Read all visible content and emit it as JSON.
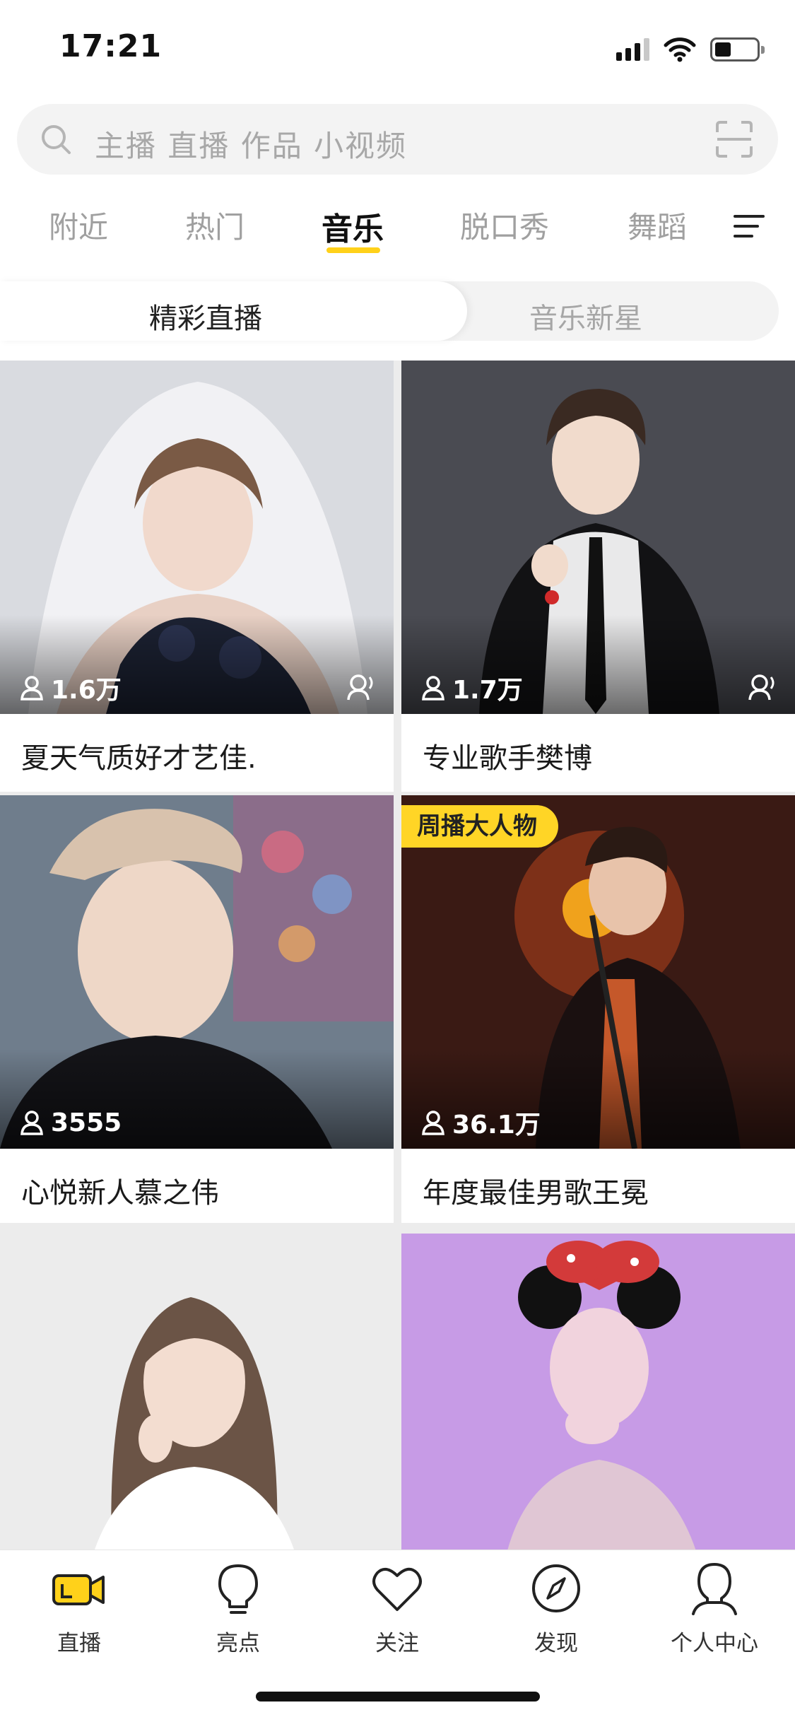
{
  "status_bar": {
    "time": "17:21"
  },
  "search": {
    "placeholder": "主播 直播 作品 小视频"
  },
  "category_tabs": [
    {
      "label": "附近",
      "active": false
    },
    {
      "label": "热门",
      "active": false
    },
    {
      "label": "音乐",
      "active": true
    },
    {
      "label": "脱口秀",
      "active": false
    },
    {
      "label": "舞蹈",
      "active": false
    }
  ],
  "segments": [
    {
      "label": "精彩直播",
      "active": true
    },
    {
      "label": "音乐新星",
      "active": false
    }
  ],
  "cards": [
    {
      "title": "夏天气质好才艺佳.",
      "viewers": "1.6万",
      "badge": "",
      "has_mic": true,
      "palette": [
        "#d9dbe0",
        "#8a8e98",
        "#1c2233"
      ]
    },
    {
      "title": "专业歌手樊博",
      "viewers": "1.7万",
      "badge": "",
      "has_mic": true,
      "palette": [
        "#4a4b52",
        "#e9e9ea",
        "#121214"
      ]
    },
    {
      "title": "心悦新人慕之伟",
      "viewers": "3555",
      "badge": "",
      "has_mic": false,
      "palette": [
        "#6f7d8c",
        "#d8c2ad",
        "#141418"
      ]
    },
    {
      "title": "年度最佳男歌王冕",
      "viewers": "36.1万",
      "badge": "周播大人物",
      "has_mic": false,
      "palette": [
        "#3a1a14",
        "#f0a21c",
        "#1a1010"
      ]
    },
    {
      "title": "",
      "viewers": "",
      "badge": "",
      "has_mic": false,
      "palette": [
        "#ececec",
        "#d5c6bb",
        "#6b5446"
      ]
    },
    {
      "title": "",
      "viewers": "",
      "badge": "",
      "has_mic": false,
      "palette": [
        "#c79be6",
        "#f1d3dd",
        "#d33a3a"
      ]
    }
  ],
  "bottom_nav": [
    {
      "label": "直播",
      "icon": "live-camera-icon",
      "active": true
    },
    {
      "label": "亮点",
      "icon": "lightbulb-icon",
      "active": false
    },
    {
      "label": "关注",
      "icon": "heart-icon",
      "active": false
    },
    {
      "label": "发现",
      "icon": "compass-icon",
      "active": false
    },
    {
      "label": "个人中心",
      "icon": "profile-icon",
      "active": false
    }
  ],
  "colors": {
    "accent": "#ffd11a",
    "badge": "#ffd526",
    "text_inactive": "#a0a0a0"
  }
}
